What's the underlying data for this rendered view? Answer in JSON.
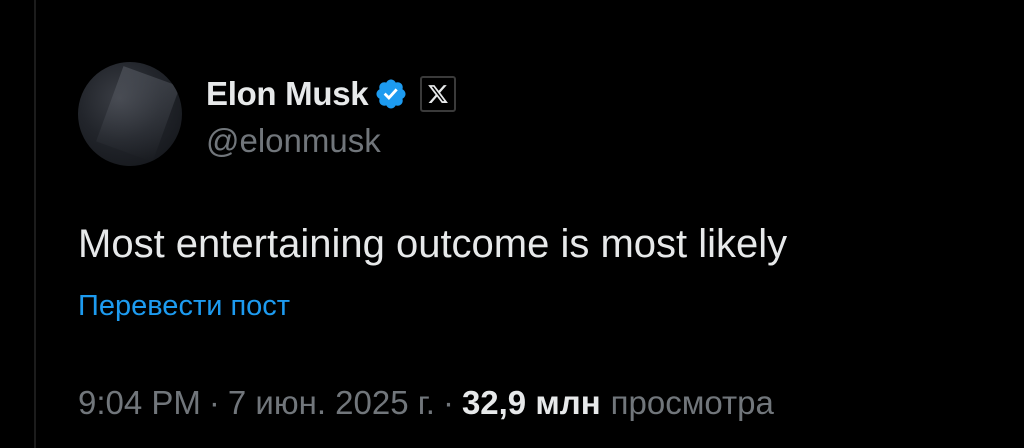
{
  "author": {
    "display_name": "Elon Musk",
    "handle": "@elonmusk",
    "verified_badge": "verified-check-icon",
    "affiliation_badge": "x-logo-icon"
  },
  "post": {
    "text": "Most entertaining outcome is most likely",
    "translate_label": "Перевести пост"
  },
  "meta": {
    "time": "9:04 PM",
    "date": "7 июн. 2025 г.",
    "separator": "·",
    "views_count": "32,9 млн",
    "views_label": "просмотра"
  },
  "colors": {
    "background": "#000000",
    "text_primary": "#e7e9ea",
    "text_secondary": "#71767b",
    "accent": "#1d9bf0"
  }
}
